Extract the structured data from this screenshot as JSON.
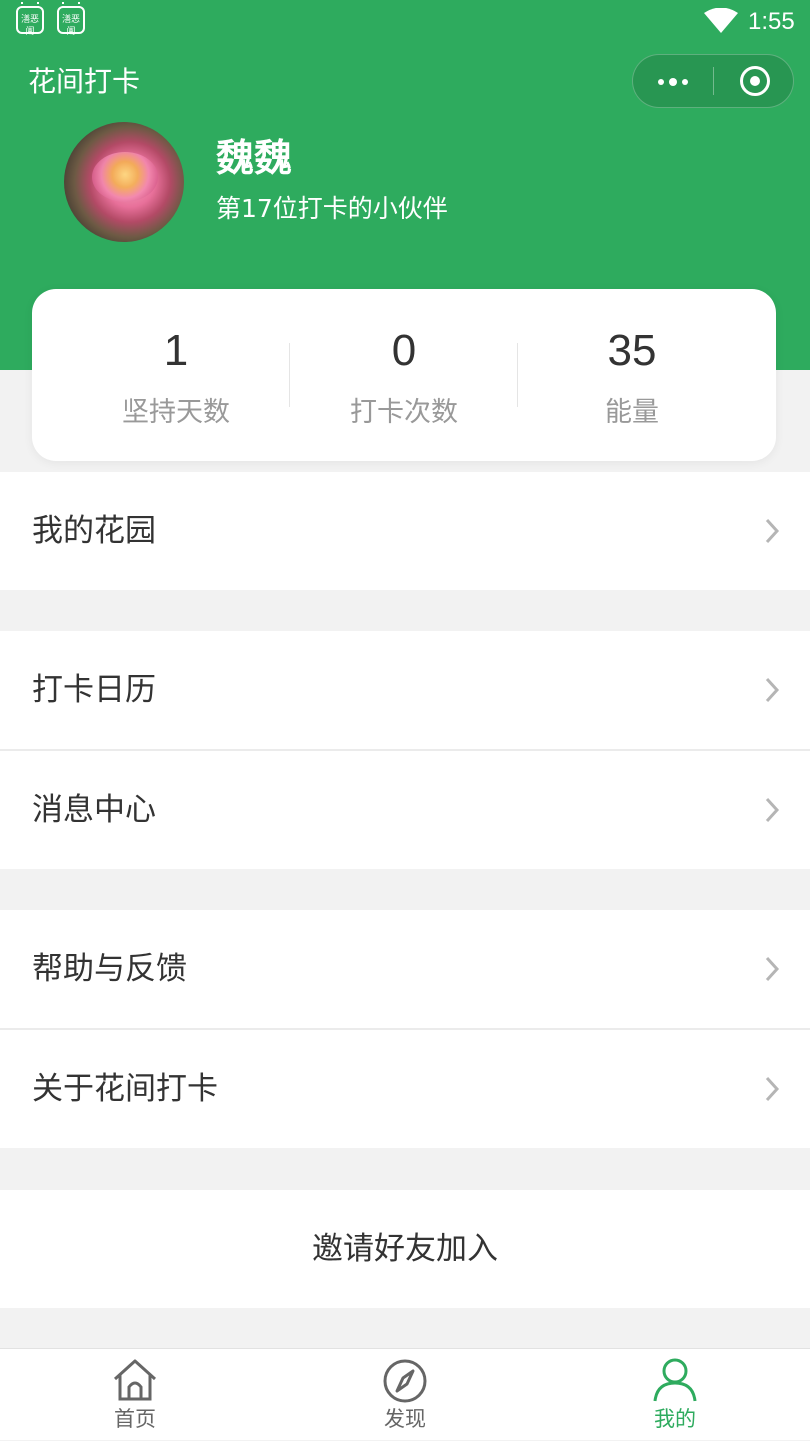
{
  "colors": {
    "brand": "#2eab5e",
    "text": "#333333",
    "muted": "#999999"
  },
  "status_bar": {
    "app_icons": [
      "㵛恶阑",
      "㵛恶阑"
    ],
    "time": "1:55"
  },
  "header": {
    "title": "花间打卡",
    "capsule": {
      "more_icon": "more-dots-icon",
      "close_icon": "target-icon"
    }
  },
  "profile": {
    "name": "魏魏",
    "subtitle": "第17位打卡的小伙伴"
  },
  "stats": [
    {
      "value": "1",
      "label": "坚持天数"
    },
    {
      "value": "0",
      "label": "打卡次数"
    },
    {
      "value": "35",
      "label": "能量"
    }
  ],
  "menu": {
    "garden": "我的花园",
    "calendar": "打卡日历",
    "messages": "消息中心",
    "help": "帮助与反馈",
    "about": "关于花间打卡",
    "invite": "邀请好友加入"
  },
  "tabs": [
    {
      "label": "首页",
      "icon": "home-icon"
    },
    {
      "label": "发现",
      "icon": "compass-icon"
    },
    {
      "label": "我的",
      "icon": "user-icon",
      "active": true
    }
  ]
}
